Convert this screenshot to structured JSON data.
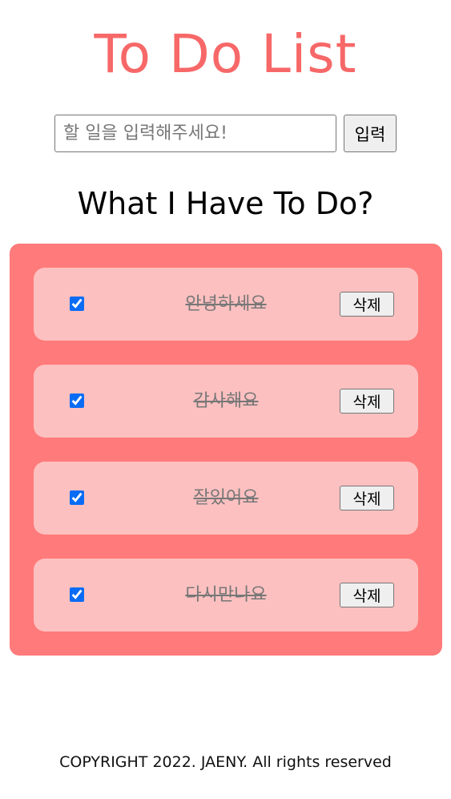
{
  "header": {
    "title": "To Do List",
    "colors": {
      "title": "#f76868"
    }
  },
  "form": {
    "input_value": "",
    "input_placeholder": "할 일을 입력해주세요!",
    "submit_label": "입력"
  },
  "list_title": "What I Have To Do?",
  "todos": [
    {
      "text": "안녕하세요",
      "checked": true,
      "delete_label": "삭제"
    },
    {
      "text": "감사해요",
      "checked": true,
      "delete_label": "삭제"
    },
    {
      "text": "잘있어요",
      "checked": true,
      "delete_label": "삭제"
    },
    {
      "text": "다시만나요",
      "checked": true,
      "delete_label": "삭제"
    }
  ],
  "colors": {
    "panel": "#ff7a7a",
    "item": "#fdc0c0",
    "done_text": "#777777"
  },
  "footer": {
    "copyright": "COPYRIGHT 2022. JAENY. All rights reserved"
  }
}
